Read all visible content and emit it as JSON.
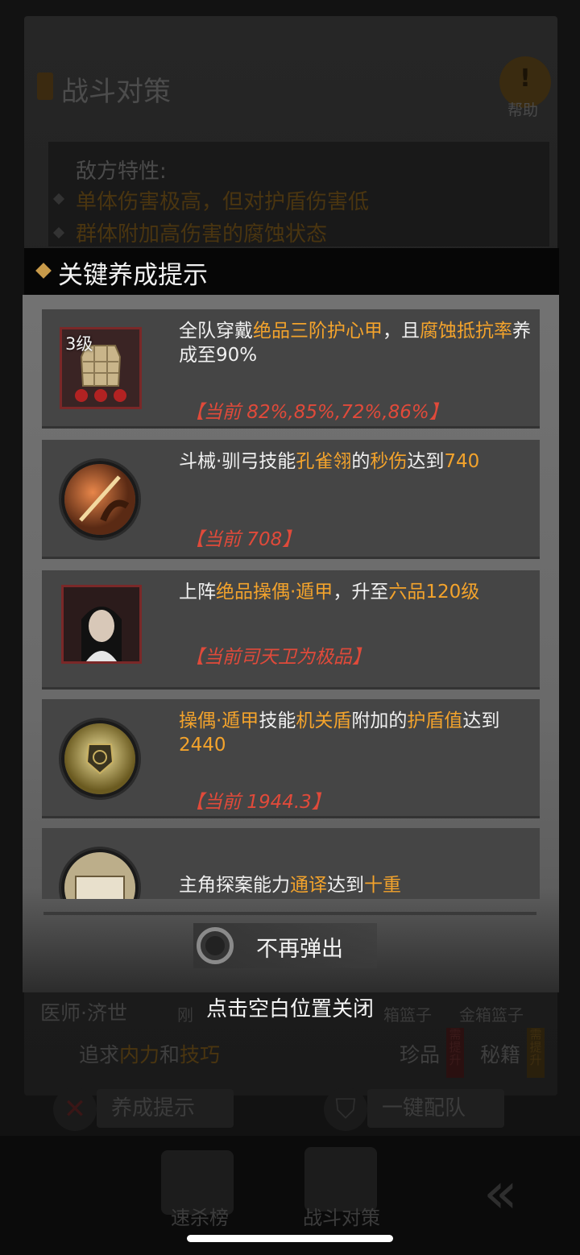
{
  "background": {
    "title": "战斗对策",
    "help_label": "帮助",
    "help_icon": "!",
    "enemy_traits_title": "敌方特性:",
    "enemy_traits": [
      "单体伤害极高，但对护盾伤害低",
      "群体附加高伤害的腐蚀状态"
    ],
    "row_labels": {
      "doctor": "医师·济世",
      "partial_just": "刚",
      "partial_box": "箱篮子",
      "gold_box": "金箱篮子"
    },
    "pursuit": {
      "prefix": "追求",
      "a": "内力",
      "and": "和",
      "b": "技巧"
    },
    "treasure": "珍品",
    "secret_book": "秘籍",
    "need_upgrade": "需提升",
    "btn_cultivation_hint": "养成提示",
    "btn_one_click_team": "一键配队",
    "nav": [
      "速杀榜",
      "战斗对策"
    ]
  },
  "dialog": {
    "title": "关键养成提示",
    "cards": [
      {
        "level": "3级",
        "segments": [
          {
            "t": "全队穿戴",
            "hl": false
          },
          {
            "t": "绝品三阶护心甲",
            "hl": true
          },
          {
            "t": "，且",
            "hl": false
          },
          {
            "t": "腐蚀抵抗率",
            "hl": true
          },
          {
            "t": "养成至90%",
            "hl": false
          }
        ],
        "current": "【当前 82%,85%,72%,86%】"
      },
      {
        "segments": [
          {
            "t": "斗械·驯弓技能",
            "hl": false
          },
          {
            "t": "孔雀翎",
            "hl": true
          },
          {
            "t": "的",
            "hl": false
          },
          {
            "t": "秒伤",
            "hl": true
          },
          {
            "t": "达到",
            "hl": false
          },
          {
            "t": "740",
            "hl": true
          }
        ],
        "current": "【当前 708】"
      },
      {
        "segments": [
          {
            "t": "上阵",
            "hl": false
          },
          {
            "t": "绝品操偶·遁甲",
            "hl": true
          },
          {
            "t": "，升至",
            "hl": false
          },
          {
            "t": "六品120级",
            "hl": true
          }
        ],
        "current": "【当前司天卫为极品】"
      },
      {
        "segments": [
          {
            "t": "操偶·遁甲",
            "hl": true
          },
          {
            "t": "技能",
            "hl": false
          },
          {
            "t": "机关盾",
            "hl": true
          },
          {
            "t": "附加的",
            "hl": false
          },
          {
            "t": "护盾值",
            "hl": true
          },
          {
            "t": "达到",
            "hl": false
          },
          {
            "t": "2440",
            "hl": true
          }
        ],
        "current": "【当前 1944.3】"
      },
      {
        "segments": [
          {
            "t": "主角探案能力",
            "hl": false
          },
          {
            "t": "通译",
            "hl": true
          },
          {
            "t": "达到",
            "hl": false
          },
          {
            "t": "十重",
            "hl": true
          }
        ],
        "current": ""
      }
    ],
    "toggle_label": "不再弹出",
    "toggle_checked": false,
    "close_hint": "点击空白位置关闭"
  },
  "colors": {
    "highlight": "#f3a32c",
    "current_value": "#e04a3a",
    "header_mark": "#c89a4a"
  }
}
